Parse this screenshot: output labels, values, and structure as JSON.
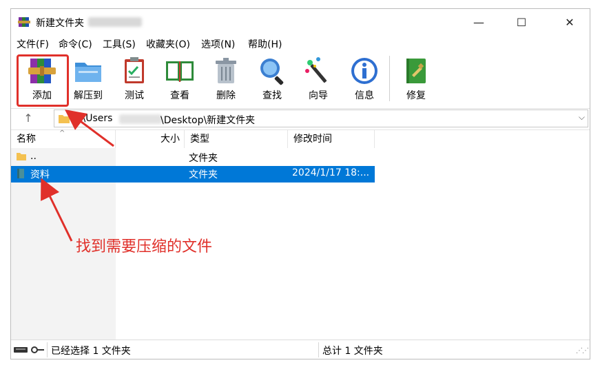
{
  "window": {
    "title": "新建文件夹",
    "minimize_glyph": "—",
    "maximize_glyph": "☐",
    "close_glyph": "✕"
  },
  "menu": [
    "文件(F)",
    "命令(C)",
    "工具(S)",
    "收藏夹(O)",
    "选项(N)",
    "帮助(H)"
  ],
  "toolbar": {
    "buttons": [
      {
        "label": "添加",
        "icon": "archive-books-icon"
      },
      {
        "label": "解压到",
        "icon": "folder-extract-icon"
      },
      {
        "label": "测试",
        "icon": "clipboard-check-icon"
      },
      {
        "label": "查看",
        "icon": "open-book-icon"
      },
      {
        "label": "删除",
        "icon": "trash-can-icon"
      },
      {
        "label": "查找",
        "icon": "magnifier-icon"
      },
      {
        "label": "向导",
        "icon": "magic-wand-icon"
      },
      {
        "label": "信息",
        "icon": "info-icon"
      },
      {
        "label": "修复",
        "icon": "repair-book-icon"
      }
    ],
    "highlighted_button": "添加",
    "highlight_color": "#e0302a"
  },
  "address": {
    "up_glyph": "↑",
    "path_prefix": "C:\\Users",
    "path_suffix": "\\Desktop\\新建文件夹",
    "dropdown_glyph": "⌵"
  },
  "columns": {
    "name": "名称",
    "size": "大小",
    "type": "类型",
    "modified": "修改时间"
  },
  "rows": [
    {
      "name": "..",
      "size": "",
      "type": "文件夹",
      "modified": "",
      "selected": false
    },
    {
      "name": "资料",
      "size": "",
      "type": "文件夹",
      "modified": "2024/1/17 18:...",
      "selected": true
    }
  ],
  "status": {
    "left": "已经选择 1 文件夹",
    "right": "总计 1 文件夹"
  },
  "annotation": {
    "text": "找到需要压缩的文件",
    "color": "#e0302a"
  },
  "colors": {
    "selection": "#0078d7",
    "folder": "#f4c150"
  }
}
